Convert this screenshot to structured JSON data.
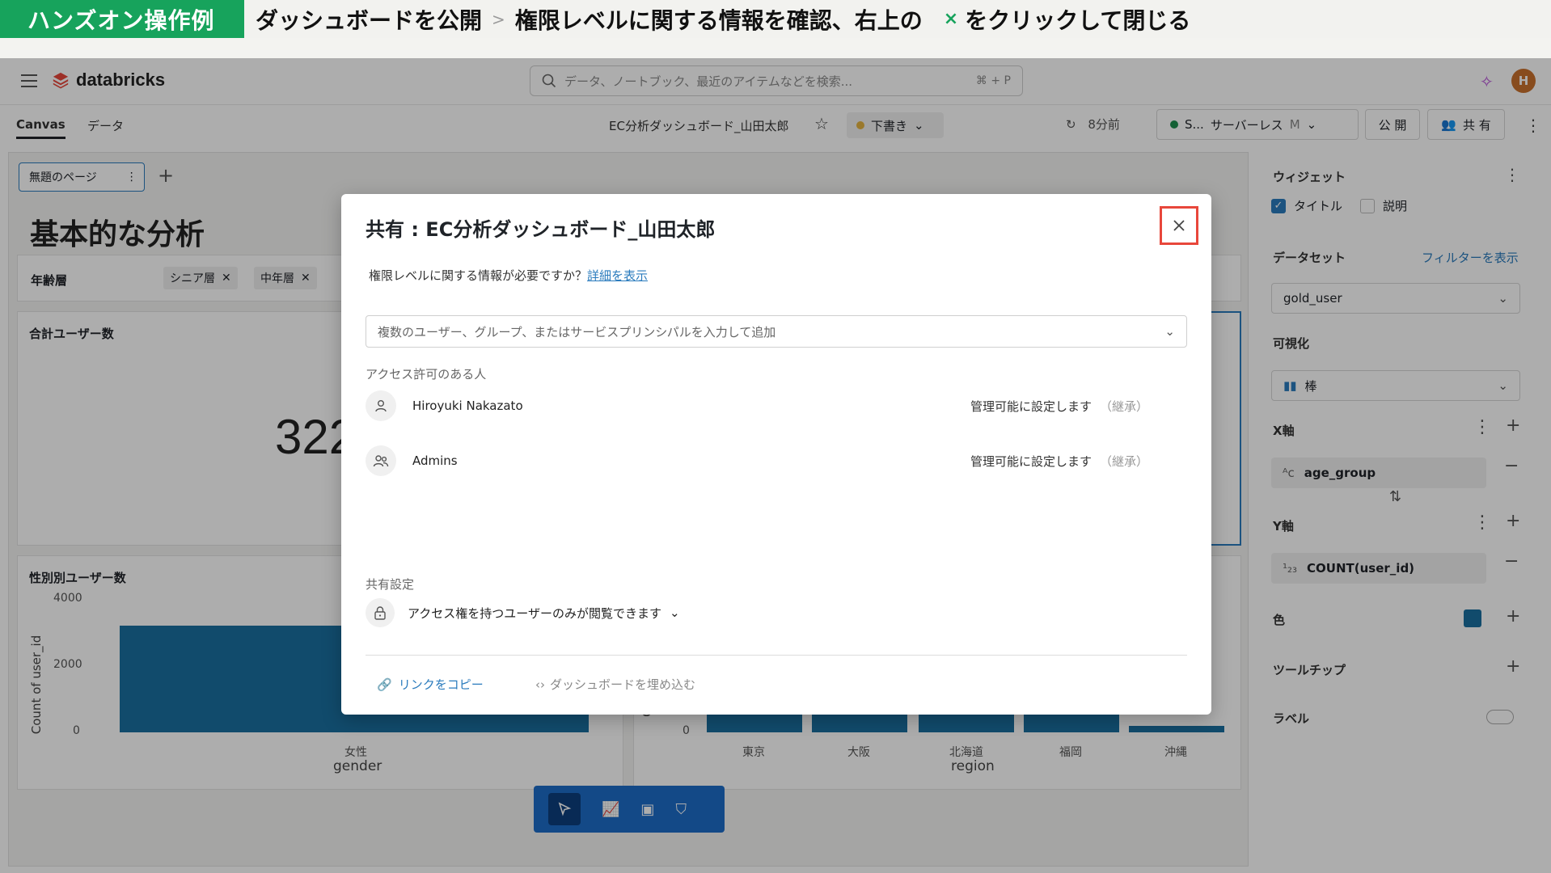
{
  "banner": {
    "tag": "ハンズオン操作例",
    "step1": "ダッシュボードを公開",
    "sep": ">",
    "step2": "権限レベルに関する情報を確認、右上の",
    "close_symbol": "×",
    "step3": "をクリックして閉じる"
  },
  "app": {
    "logo": "databricks",
    "search_placeholder": "データ、ノートブック、最近のアイテムなどを検索...",
    "search_shortcut": "⌘ + P",
    "avatar": "H"
  },
  "toolbar": {
    "tabs": [
      "Canvas",
      "データ"
    ],
    "dashboard_title": "EC分析ダッシュボード_山田太郎",
    "draft": "下書き",
    "updated": "8分前",
    "warehouse_short": "S...",
    "warehouse_name": "サーバーレス",
    "warehouse_size": "M",
    "publish": "公 開",
    "share": "共 有"
  },
  "canvas": {
    "page_tab": "無題のページ",
    "heading": "基本的な分析",
    "filter_label": "年齢層",
    "filter_chips": [
      "シニア層",
      "中年層"
    ],
    "card_total_title": "合計ユーザー数",
    "card_total_value": "322",
    "card_gender_title": "性別別ユーザー数",
    "gender_yaxis": "Count of user_id",
    "gender_ticks": [
      "4000",
      "2000",
      "0"
    ],
    "gender_category": "女性",
    "gender_xlabel": "gender",
    "region_ylabel_partial": "Co",
    "region_zero": "0",
    "regions": [
      "東京",
      "大阪",
      "北海道",
      "福岡",
      "沖縄"
    ],
    "region_xlabel": "region"
  },
  "right_panel": {
    "widget_label": "ウィジェット",
    "title_checkbox": "タイトル",
    "desc_checkbox": "説明",
    "dataset_label": "データセット",
    "show_filters": "フィルターを表示",
    "dataset_value": "gold_user",
    "viz_label": "可視化",
    "viz_value": "棒",
    "x_axis_label": "X軸",
    "x_field": "age_group",
    "y_axis_label": "Y軸",
    "y_field": "COUNT(user_id)",
    "color_label": "色",
    "color_swatch": "#1a6fa0",
    "tooltip_label": "ツールチップ",
    "label_label": "ラベル"
  },
  "modal": {
    "title": "共有 : EC分析ダッシュボード_山田太郎",
    "info_text": "権限レベルに関する情報が必要ですか？",
    "info_link": "詳細を表示",
    "input_placeholder": "複数のユーザー、グループ、またはサービスプリンシパルを入力して追加",
    "access_label": "アクセス許可のある人",
    "people": [
      {
        "name": "Hiroyuki Nakazato",
        "permission": "管理可能に設定します",
        "inherited": "（継承）",
        "icon": "user-icon"
      },
      {
        "name": "Admins",
        "permission": "管理可能に設定します",
        "inherited": "（継承）",
        "icon": "group-icon"
      }
    ],
    "sharing_label": "共有設定",
    "visibility": "アクセス権を持つユーザーのみが閲覧できます",
    "copy_link": "リンクをコピー",
    "embed": "ダッシュボードを埋め込む"
  },
  "colors": {
    "accent": "#17a35c",
    "link": "#2a7bbd",
    "bar": "#1a6fa0",
    "highlight": "#e8473b",
    "draft_dot": "#e3b341",
    "online_dot": "#1e8e4e"
  }
}
